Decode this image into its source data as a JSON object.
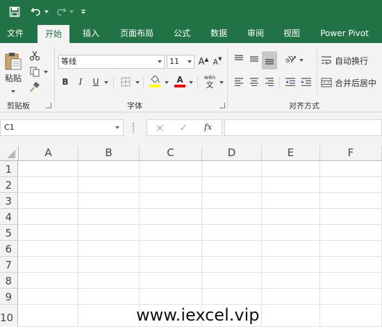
{
  "quick_access": {
    "save_icon": "save-icon",
    "undo_icon": "undo-icon",
    "redo_icon": "redo-icon",
    "customize_icon": "customize-qat-icon"
  },
  "tabs": [
    "文件",
    "开始",
    "插入",
    "页面布局",
    "公式",
    "数据",
    "审阅",
    "视图",
    "Power Pivot"
  ],
  "active_tab": "开始",
  "ribbon": {
    "clipboard": {
      "paste_label": "粘贴",
      "group_label": "剪贴板"
    },
    "font": {
      "font_name": "等线",
      "font_size": "11",
      "grow_label": "A",
      "shrink_label": "A",
      "bold": "B",
      "italic": "I",
      "underline": "U",
      "font_color_label": "A",
      "phonetic_top": "wén",
      "phonetic_bottom": "文",
      "group_label": "字体",
      "highlight_color": "#ffff00",
      "font_color": "#ff0000"
    },
    "alignment": {
      "wrap_text": "自动换行",
      "merge_center": "合并后居中",
      "group_label": "对齐方式"
    }
  },
  "formula_bar": {
    "name_box": "C1",
    "fx_label": "fx",
    "formula": ""
  },
  "sheet": {
    "columns": [
      "A",
      "B",
      "C",
      "D",
      "E",
      "F"
    ],
    "rows": [
      "1",
      "2",
      "3",
      "4",
      "5",
      "6",
      "7",
      "8",
      "9",
      "10"
    ]
  },
  "watermark": "www.iexcel.vip",
  "colors": {
    "brand_green": "#217346",
    "ribbon_bg": "#f3f3f3"
  }
}
